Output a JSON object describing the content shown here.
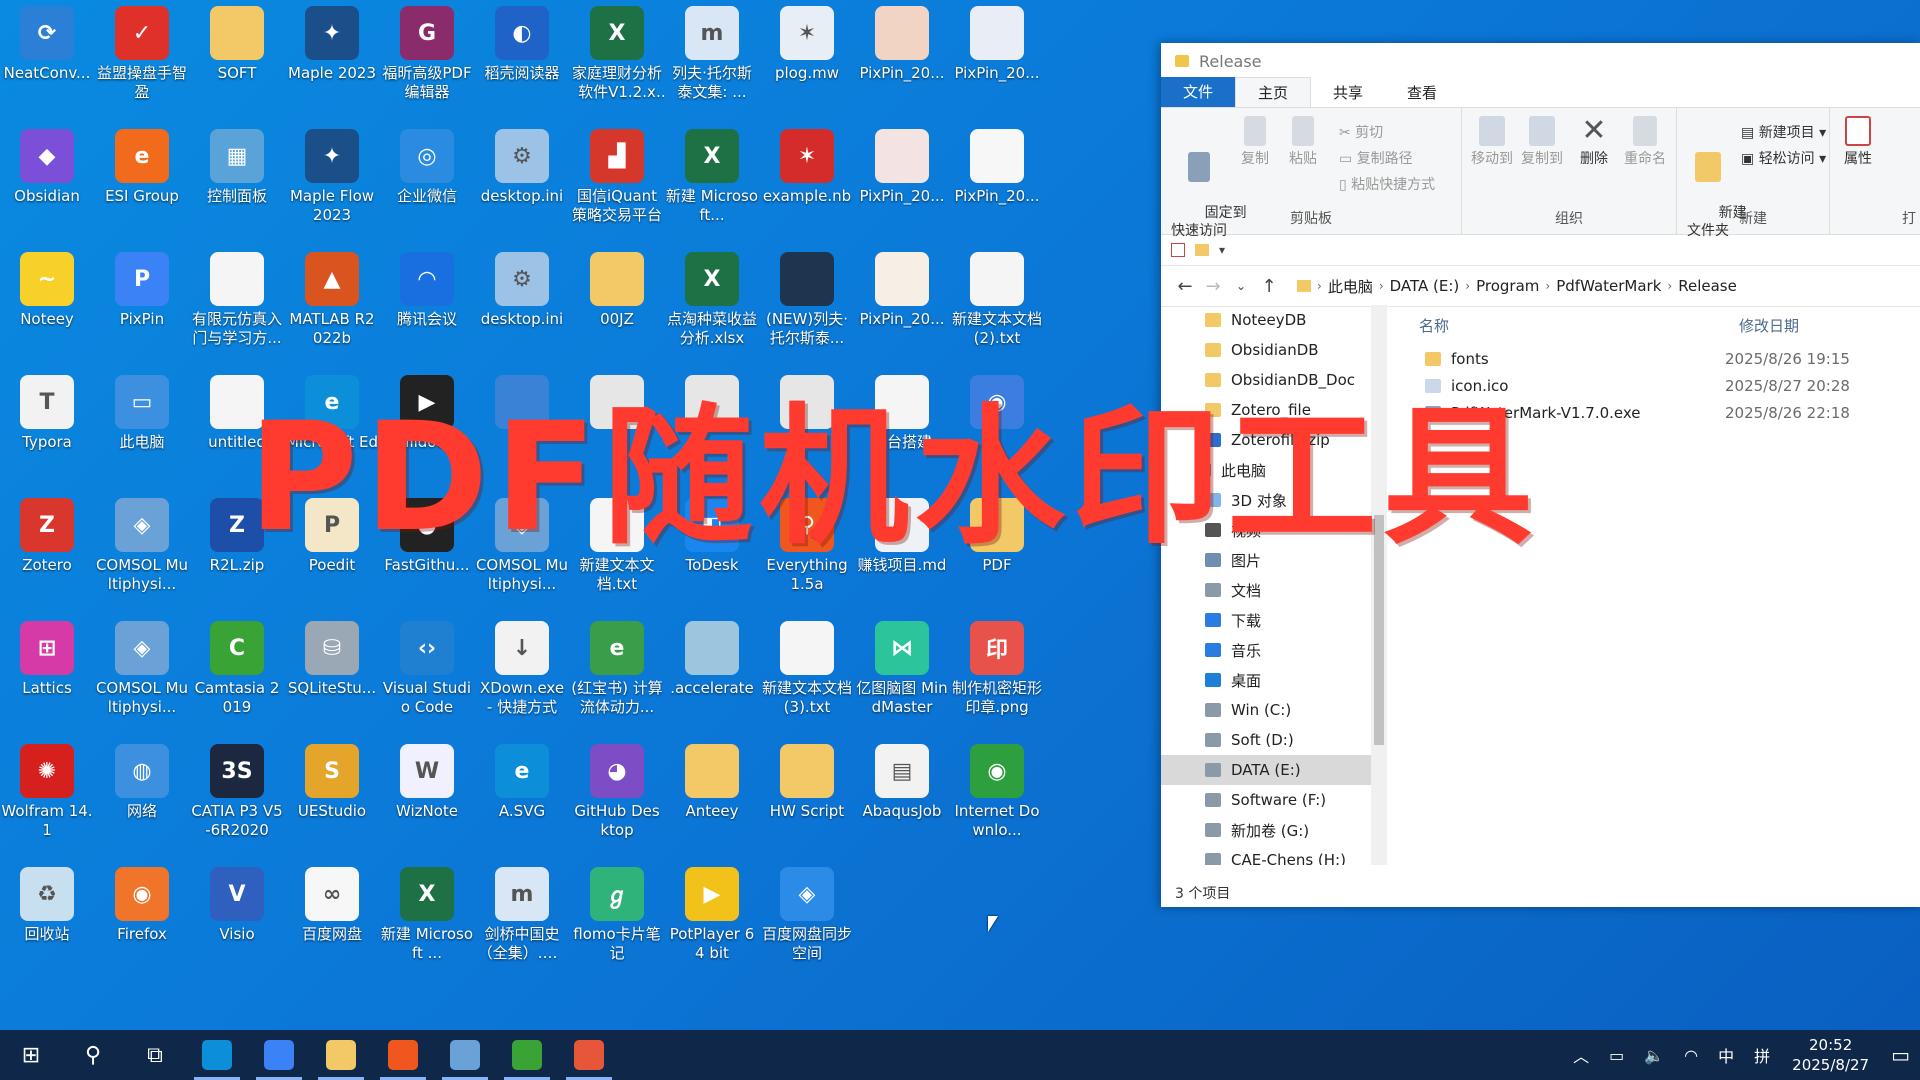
{
  "overlay_title": "PDF随机水印工具",
  "desktop_icons": [
    {
      "label": "NeatConv...",
      "icon": "neatconverter-icon",
      "color": "#2b7fd6",
      "glyph": "⟳"
    },
    {
      "label": "益盟操盘手智盈",
      "icon": "yimeng-icon",
      "color": "#e0302a",
      "glyph": "✓"
    },
    {
      "label": "SOFT",
      "icon": "folder-icon",
      "color": "#f3c867",
      "glyph": ""
    },
    {
      "label": "Maple 2023",
      "icon": "maple-icon",
      "color": "#1b4f8a",
      "glyph": "✦"
    },
    {
      "label": "福昕高级PDF编辑器",
      "icon": "foxit-icon",
      "color": "#8a2b6c",
      "glyph": "G"
    },
    {
      "label": "稻壳阅读器",
      "icon": "docer-icon",
      "color": "#1f63c8",
      "glyph": "◐"
    },
    {
      "label": "家庭理财分析软件V1.2.xl...",
      "icon": "excel-icon",
      "color": "#1e7145",
      "glyph": "X"
    },
    {
      "label": "列夫·托尔斯泰文集: ...",
      "icon": "mobi-icon",
      "color": "#d8e6f5",
      "glyph": "m"
    },
    {
      "label": "plog.mw",
      "icon": "mathematica-file-icon",
      "color": "#e8eef5",
      "glyph": "✶"
    },
    {
      "label": "PixPin_20...",
      "icon": "image-file-icon",
      "color": "#f2d4c4",
      "glyph": ""
    },
    {
      "label": "PixPin_20...",
      "icon": "image-file-icon",
      "color": "#e9eef6",
      "glyph": ""
    },
    {
      "label": "Obsidian",
      "icon": "obsidian-icon",
      "color": "#7b4fd8",
      "glyph": "◆"
    },
    {
      "label": "ESI Group",
      "icon": "esi-icon",
      "color": "#f26a1b",
      "glyph": "e"
    },
    {
      "label": "控制面板",
      "icon": "control-panel-icon",
      "color": "#5aa3d8",
      "glyph": "▦"
    },
    {
      "label": "Maple Flow 2023",
      "icon": "maple-flow-icon",
      "color": "#1b4f8a",
      "glyph": "✦"
    },
    {
      "label": "企业微信",
      "icon": "wecom-icon",
      "color": "#2a8be0",
      "glyph": "◎"
    },
    {
      "label": "desktop.ini",
      "icon": "settings-file-icon",
      "color": "#9cc2e6",
      "glyph": "⚙"
    },
    {
      "label": "国信iQuant策略交易平台",
      "icon": "iquant-icon",
      "color": "#d6372b",
      "glyph": "▟"
    },
    {
      "label": "新建 Microsoft...",
      "icon": "excel-icon",
      "color": "#1e7145",
      "glyph": "X"
    },
    {
      "label": "example.nb",
      "icon": "mathematica-file-icon",
      "color": "#d42b2b",
      "glyph": "✶"
    },
    {
      "label": "PixPin_20...",
      "icon": "image-file-icon",
      "color": "#f3e3e3",
      "glyph": ""
    },
    {
      "label": "PixPin_20...",
      "icon": "image-file-icon",
      "color": "#f7f7f7",
      "glyph": ""
    },
    {
      "label": "Noteey",
      "icon": "noteey-icon",
      "color": "#f7d12a",
      "glyph": "~"
    },
    {
      "label": "PixPin",
      "icon": "pixpin-icon",
      "color": "#3b82f6",
      "glyph": "P"
    },
    {
      "label": "有限元仿真入门与学习方...",
      "icon": "text-file-icon",
      "color": "#f5f5f5",
      "glyph": ""
    },
    {
      "label": "MATLAB R2022b",
      "icon": "matlab-icon",
      "color": "#d9541e",
      "glyph": "▲"
    },
    {
      "label": "腾讯会议",
      "icon": "tencent-meeting-icon",
      "color": "#1a6fe0",
      "glyph": "◠"
    },
    {
      "label": "desktop.ini",
      "icon": "settings-file-icon",
      "color": "#9cc2e6",
      "glyph": "⚙"
    },
    {
      "label": "00JZ",
      "icon": "folder-icon",
      "color": "#f3c867",
      "glyph": ""
    },
    {
      "label": "点淘种菜收益分析.xlsx",
      "icon": "excel-icon",
      "color": "#1e7145",
      "glyph": "X"
    },
    {
      "label": "(NEW)列夫·托尔斯泰...",
      "icon": "book-cover-icon",
      "color": "#1e3550",
      "glyph": ""
    },
    {
      "label": "PixPin_20...",
      "icon": "image-file-icon",
      "color": "#f5efe6",
      "glyph": ""
    },
    {
      "label": "新建文本文档 (2).txt",
      "icon": "text-file-icon",
      "color": "#f5f5f5",
      "glyph": ""
    },
    {
      "label": "Typora",
      "icon": "typora-icon",
      "color": "#f2f2f2",
      "glyph": "T"
    },
    {
      "label": "此电脑",
      "icon": "this-pc-icon",
      "color": "#3d8fe0",
      "glyph": "▭"
    },
    {
      "label": "untitled",
      "icon": "text-file-icon",
      "color": "#f5f5f5",
      "glyph": ""
    },
    {
      "label": "Microsoft Edge",
      "icon": "edge-icon",
      "color": "#0c8fd8",
      "glyph": "e"
    },
    {
      "label": "bilidown",
      "icon": "bilidown-icon",
      "color": "#222",
      "glyph": "▶"
    },
    {
      "label": "",
      "icon": "app-icon",
      "color": "#3a82d6",
      "glyph": ""
    },
    {
      "label": "",
      "icon": "app-icon",
      "color": "#e6e6e6",
      "glyph": ""
    },
    {
      "label": "",
      "icon": "app-icon",
      "color": "#e6e6e6",
      "glyph": ""
    },
    {
      "label": "",
      "icon": "app-icon",
      "color": "#e6e6e6",
      "glyph": ""
    },
    {
      "label": "平台搭建",
      "icon": "text-file-icon",
      "color": "#f5f5f5",
      "glyph": ""
    },
    {
      "label": "",
      "icon": "app-icon",
      "color": "#3b7de0",
      "glyph": "◉"
    },
    {
      "label": "Zotero",
      "icon": "zotero-icon",
      "color": "#d9362e",
      "glyph": "Z"
    },
    {
      "label": "COMSOL Multiphysi...",
      "icon": "comsol-icon",
      "color": "#6aa2d8",
      "glyph": "◈"
    },
    {
      "label": "R2L.zip",
      "icon": "zip-icon",
      "color": "#1d4fa8",
      "glyph": "Z"
    },
    {
      "label": "Poedit",
      "icon": "poedit-icon",
      "color": "#f4e7c8",
      "glyph": "P"
    },
    {
      "label": "FastGithu...",
      "icon": "fastgithub-icon",
      "color": "#222",
      "glyph": "◕"
    },
    {
      "label": "COMSOL Multiphysi...",
      "icon": "comsol-icon",
      "color": "#6aa2d8",
      "glyph": "◈"
    },
    {
      "label": "新建文本文档.txt",
      "icon": "text-file-icon",
      "color": "#f5f5f5",
      "glyph": ""
    },
    {
      "label": "ToDesk",
      "icon": "todesk-icon",
      "color": "#1a86f0",
      "glyph": "◧"
    },
    {
      "label": "Everything 1.5a",
      "icon": "everything-icon",
      "color": "#f0571e",
      "glyph": "⚲"
    },
    {
      "label": "赚钱项目.md",
      "icon": "markdown-file-icon",
      "color": "#eef1f5",
      "glyph": ""
    },
    {
      "label": "PDF",
      "icon": "folder-icon",
      "color": "#f3c867",
      "glyph": ""
    },
    {
      "label": "Lattics",
      "icon": "lattics-icon",
      "color": "#d63aa6",
      "glyph": "⊞"
    },
    {
      "label": "COMSOL Multiphysi...",
      "icon": "comsol-icon",
      "color": "#6aa2d8",
      "glyph": "◈"
    },
    {
      "label": "Camtasia 2019",
      "icon": "camtasia-icon",
      "color": "#3aa335",
      "glyph": "C"
    },
    {
      "label": "SQLiteStu...",
      "icon": "sqlitestudio-icon",
      "color": "#9aa7b5",
      "glyph": "⛁"
    },
    {
      "label": "Visual Studio Code",
      "icon": "vscode-icon",
      "color": "#1f7fd0",
      "glyph": "‹›"
    },
    {
      "label": "XDown.exe - 快捷方式",
      "icon": "xdown-icon",
      "color": "#f2f2f2",
      "glyph": "↓"
    },
    {
      "label": "(红宝书) 计算流体动力...",
      "icon": "epub-icon",
      "color": "#3a9d4a",
      "glyph": "e"
    },
    {
      "label": ".accelerate",
      "icon": "folder-icon",
      "color": "#9cc6dd",
      "glyph": ""
    },
    {
      "label": "新建文本文档 (3).txt",
      "icon": "text-file-icon",
      "color": "#f5f5f5",
      "glyph": ""
    },
    {
      "label": "亿图脑图 MindMaster",
      "icon": "mindmaster-icon",
      "color": "#2cc49a",
      "glyph": "⋈"
    },
    {
      "label": "制作机密矩形印章.png",
      "icon": "stamp-image-icon",
      "color": "#e8524a",
      "glyph": "印"
    },
    {
      "label": "Wolfram 14.1",
      "icon": "wolfram-icon",
      "color": "#d6201d",
      "glyph": "✺"
    },
    {
      "label": "网络",
      "icon": "network-icon",
      "color": "#3d8fe0",
      "glyph": "◍"
    },
    {
      "label": "CATIA P3 V5-6R2020",
      "icon": "catia-icon",
      "color": "#1c2740",
      "glyph": "3S"
    },
    {
      "label": "UEStudio",
      "icon": "uestudio-icon",
      "color": "#e4a52a",
      "glyph": "S"
    },
    {
      "label": "WizNote",
      "icon": "wiznote-icon",
      "color": "#f0f0ff",
      "glyph": "W"
    },
    {
      "label": "A.SVG",
      "icon": "edge-icon",
      "color": "#0c8fd8",
      "glyph": "e"
    },
    {
      "label": "GitHub Desktop",
      "icon": "github-desktop-icon",
      "color": "#7c4dc4",
      "glyph": "◕"
    },
    {
      "label": "Anteey",
      "icon": "folder-icon",
      "color": "#f3c867",
      "glyph": ""
    },
    {
      "label": "HW Script",
      "icon": "folder-icon",
      "color": "#f3c867",
      "glyph": ""
    },
    {
      "label": "AbaqusJob",
      "icon": "abaqus-icon",
      "color": "#f2f2f2",
      "glyph": "▤"
    },
    {
      "label": "Internet Downlo...",
      "icon": "idm-icon",
      "color": "#2e9f3e",
      "glyph": "◉"
    },
    {
      "label": "回收站",
      "icon": "recycle-bin-icon",
      "color": "#c8dff0",
      "glyph": "♻"
    },
    {
      "label": "Firefox",
      "icon": "firefox-icon",
      "color": "#f0742a",
      "glyph": "◉"
    },
    {
      "label": "Visio",
      "icon": "visio-icon",
      "color": "#2f5fbf",
      "glyph": "V"
    },
    {
      "label": "百度网盘",
      "icon": "baidu-netdisk-icon",
      "color": "#f7f7f7",
      "glyph": "∞"
    },
    {
      "label": "新建 Microsoft ...",
      "icon": "excel-icon",
      "color": "#1e7145",
      "glyph": "X"
    },
    {
      "label": "剑桥中国史（全集）.mobi",
      "icon": "mobi-icon",
      "color": "#d8e6f5",
      "glyph": "m"
    },
    {
      "label": "flomo卡片笔记",
      "icon": "flomo-icon",
      "color": "#2fb37a",
      "glyph": "ℊ"
    },
    {
      "label": "PotPlayer 64 bit",
      "icon": "potplayer-icon",
      "color": "#f3c21a",
      "glyph": "▶"
    },
    {
      "label": "百度网盘同步空间",
      "icon": "baidu-sync-icon",
      "color": "#2b8be6",
      "glyph": "◈"
    }
  ],
  "explorer": {
    "title": "Release",
    "tabs": [
      "文件",
      "主页",
      "共享",
      "查看"
    ],
    "ribbon": {
      "clipboard": {
        "pin": "固定到\n快速访问",
        "copy": "复制",
        "paste": "粘贴",
        "cut": "剪切",
        "copy_path": "复制路径",
        "paste_shortcut": "粘贴快捷方式",
        "label": "剪贴板"
      },
      "organize": {
        "move_to": "移动到",
        "copy_to": "复制到",
        "delete": "删除",
        "rename": "重命名",
        "label": "组织"
      },
      "new": {
        "new_folder": "新建\n文件夹",
        "new_item": "新建项目 ▾",
        "easy_access": "轻松访问 ▾",
        "label": "新建"
      },
      "open": {
        "properties": "属性",
        "label": "打"
      }
    },
    "breadcrumb": [
      "此电脑",
      "DATA (E:)",
      "Program",
      "PdfWaterMark",
      "Release"
    ],
    "nav_tree": [
      {
        "label": "NoteeyDB",
        "icon": "folder-icon",
        "color": "#f3c867"
      },
      {
        "label": "ObsidianDB",
        "icon": "folder-icon",
        "color": "#f3c867"
      },
      {
        "label": "ObsidianDB_Doc",
        "icon": "folder-icon",
        "color": "#f3c867"
      },
      {
        "label": "Zotero_file",
        "icon": "folder-icon",
        "color": "#f3c867"
      },
      {
        "label": "Zoterofile.zip",
        "icon": "zip-icon",
        "color": "#2a6fd0"
      },
      {
        "label": "此电脑",
        "icon": "this-pc-icon",
        "color": "#3d8fe0"
      },
      {
        "label": "3D 对象",
        "icon": "3d-objects-icon",
        "color": "#7fb5e8"
      },
      {
        "label": "视频",
        "icon": "videos-icon",
        "color": "#555"
      },
      {
        "label": "图片",
        "icon": "pictures-icon",
        "color": "#6d8fb0"
      },
      {
        "label": "文档",
        "icon": "documents-icon",
        "color": "#8a9aa8"
      },
      {
        "label": "下载",
        "icon": "downloads-icon",
        "color": "#2a7de0"
      },
      {
        "label": "音乐",
        "icon": "music-icon",
        "color": "#2a7de0"
      },
      {
        "label": "桌面",
        "icon": "desktop-icon",
        "color": "#1e7fd8"
      },
      {
        "label": "Win (C:)",
        "icon": "drive-icon",
        "color": "#8a9aa8"
      },
      {
        "label": "Soft (D:)",
        "icon": "drive-icon",
        "color": "#8a9aa8"
      },
      {
        "label": "DATA (E:)",
        "icon": "drive-icon",
        "color": "#8a9aa8"
      },
      {
        "label": "Software (F:)",
        "icon": "drive-icon",
        "color": "#8a9aa8"
      },
      {
        "label": "新加卷 (G:)",
        "icon": "drive-icon",
        "color": "#8a9aa8"
      },
      {
        "label": "CAE-Chens (H:)",
        "icon": "drive-icon",
        "color": "#8a9aa8"
      }
    ],
    "selected_nav": "DATA (E:)",
    "columns": {
      "name": "名称",
      "modified": "修改日期"
    },
    "files": [
      {
        "name": "fonts",
        "date": "2025/8/26 19:15",
        "icon": "folder-icon",
        "color": "#f3c867"
      },
      {
        "name": "icon.ico",
        "date": "2025/8/27 20:28",
        "icon": "image-file-icon",
        "color": "#c9d8ea"
      },
      {
        "name": "PdfWaterMark-V1.7.0.exe",
        "date": "2025/8/26 22:18",
        "icon": "exe-file-icon",
        "color": "#8aa4c2"
      }
    ],
    "status": "3 个项目"
  },
  "taskbar": {
    "apps": [
      {
        "name": "start-button",
        "icon": "windows-icon",
        "color": "#ffffff"
      },
      {
        "name": "search-button",
        "icon": "search-icon",
        "color": "#ffffff"
      },
      {
        "name": "task-view-button",
        "icon": "task-view-icon",
        "color": "#ffffff"
      },
      {
        "name": "edge-taskbar",
        "icon": "edge-icon",
        "color": "#0c8fd8"
      },
      {
        "name": "pixpin-taskbar",
        "icon": "pixpin-icon",
        "color": "#3b82f6"
      },
      {
        "name": "explorer-taskbar",
        "icon": "file-explorer-icon",
        "color": "#f3c867"
      },
      {
        "name": "everything-taskbar",
        "icon": "everything-icon",
        "color": "#f0571e"
      },
      {
        "name": "comsol-taskbar",
        "icon": "comsol-icon",
        "color": "#6aa2d8"
      },
      {
        "name": "camtasia-taskbar",
        "icon": "camtasia-icon",
        "color": "#3aa335"
      },
      {
        "name": "camtasia-recorder-taskbar",
        "icon": "camtasia-recorder-icon",
        "color": "#e8563a"
      }
    ],
    "tray": {
      "ime_lang": "中",
      "ime_mode": "拼",
      "time": "20:52",
      "date": "2025/8/27"
    }
  }
}
